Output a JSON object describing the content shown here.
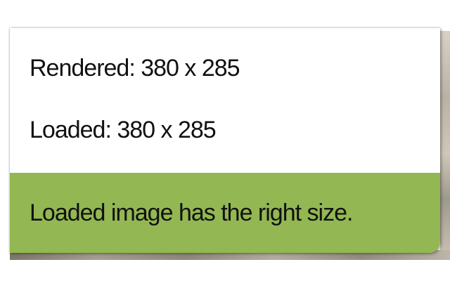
{
  "tooltip": {
    "rendered_label": "Rendered: 380 x 285",
    "loaded_label": "Loaded: 380 x 285",
    "status_message": "Loaded image has the right size.",
    "status_color": "#93b752"
  }
}
